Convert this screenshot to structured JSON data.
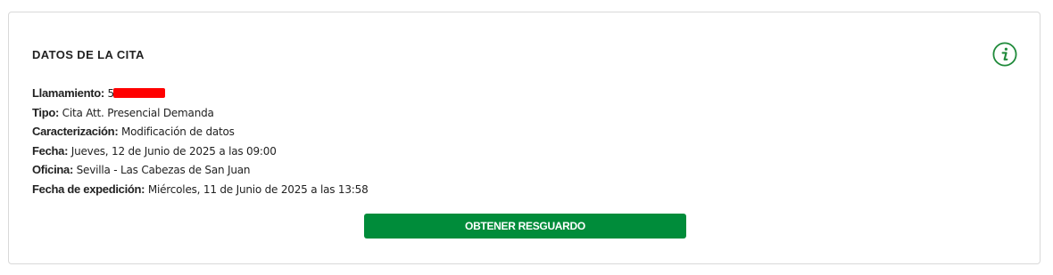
{
  "card": {
    "title": "DATOS DE LA CITA",
    "info_icon": "info-icon",
    "fields": {
      "llamamiento": {
        "label": "Llamamiento:",
        "value": "5"
      },
      "tipo": {
        "label": "Tipo:",
        "value": "Cita Att. Presencial Demanda"
      },
      "caracterizacion": {
        "label": "Caracterización:",
        "value": "Modificación de datos"
      },
      "fecha": {
        "label": "Fecha:",
        "value": "Jueves, 12 de Junio de 2025 a las 09:00"
      },
      "oficina": {
        "label": "Oficina:",
        "value": "Sevilla - Las Cabezas de San Juan"
      },
      "fecha_expedicion": {
        "label": "Fecha de expedición:",
        "value": "Miércoles, 11 de Junio de 2025 a las 13:58"
      }
    },
    "button_label": "OBTENER RESGUARDO"
  },
  "colors": {
    "accent": "#008c3a",
    "redaction": "#ff0000",
    "border": "#d9d9d9"
  }
}
